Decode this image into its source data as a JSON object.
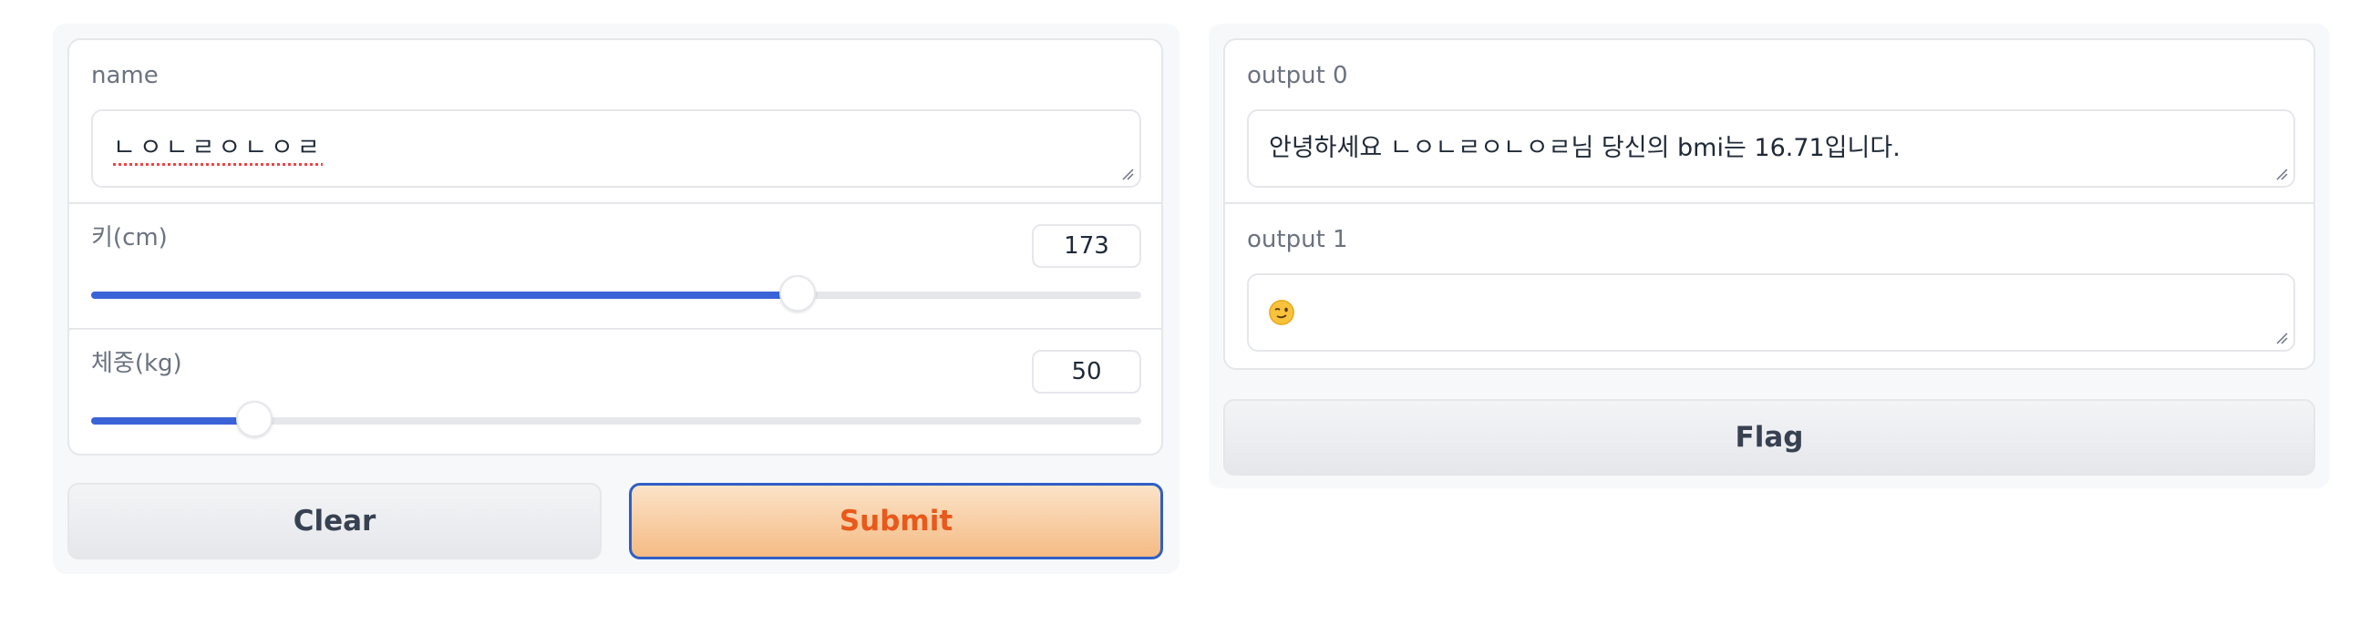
{
  "inputs": {
    "name": {
      "label": "name",
      "value": "ㄴㅇㄴㄹㅇㄴㅇㄹ"
    },
    "height": {
      "label": "키(cm)",
      "value": "173",
      "fraction": 0.673
    },
    "weight": {
      "label": "체중(kg)",
      "value": "50",
      "fraction": 0.155
    }
  },
  "buttons": {
    "clear_label": "Clear",
    "submit_label": "Submit",
    "flag_label": "Flag"
  },
  "outputs": {
    "output0": {
      "label": "output 0",
      "value": "안녕하세요 ㄴㅇㄴㄹㅇㄴㅇㄹ님 당신의 bmi는 16.71입니다."
    },
    "output1": {
      "label": "output 1",
      "emoji_icon": "winking-face-icon"
    }
  },
  "colors": {
    "accent": "#3b63d8",
    "primary_text": "#e8591b",
    "primary_border": "#2f5fc4"
  }
}
